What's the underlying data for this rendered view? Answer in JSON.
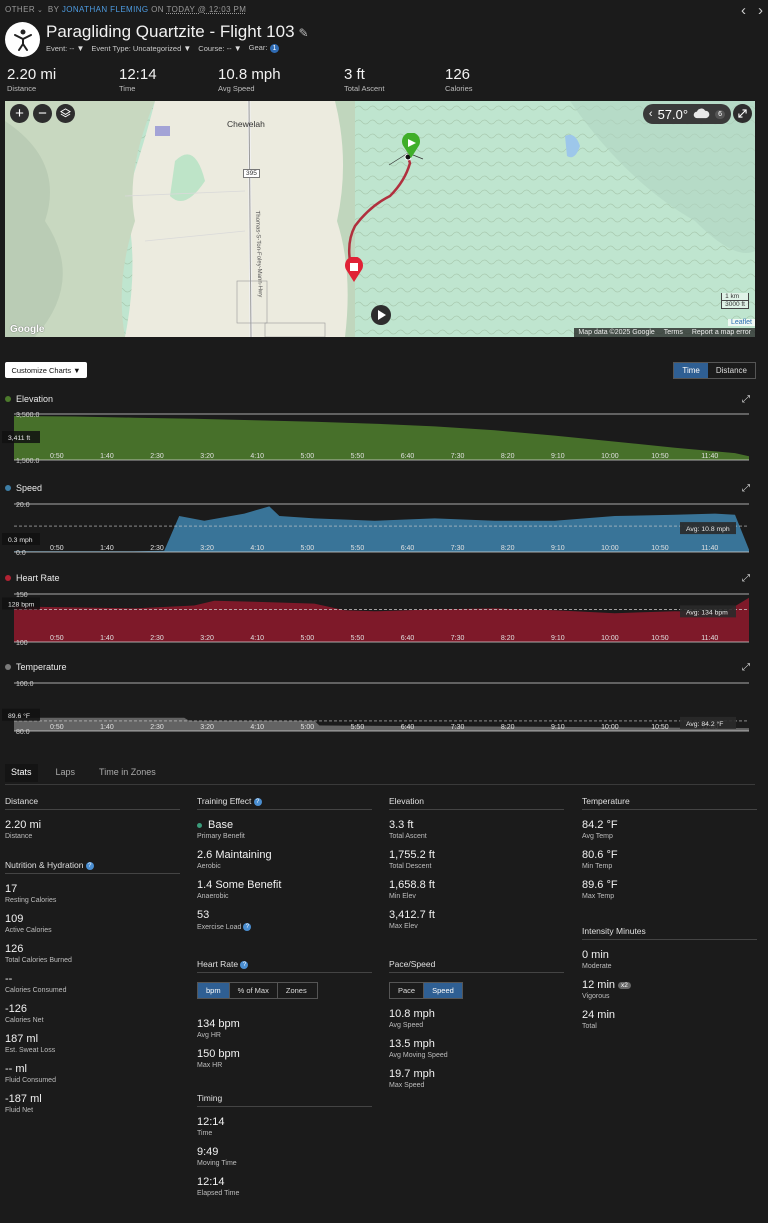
{
  "header": {
    "activity_type": "OTHER",
    "by": "BY",
    "author": "JONATHAN FLEMING",
    "on": "ON",
    "date": "TODAY @ 12:03 PM",
    "title": "Paragliding Quartzite - Flight 103",
    "event": "Event: --",
    "event_type": "Event Type: Uncategorized",
    "course": "Course: --",
    "gear": "Gear:",
    "gear_count": "1"
  },
  "summary": [
    {
      "value": "2.20 mi",
      "label": "Distance"
    },
    {
      "value": "12:14",
      "label": "Time"
    },
    {
      "value": "10.8 mph",
      "label": "Avg Speed"
    },
    {
      "value": "3 ft",
      "label": "Total Ascent"
    },
    {
      "value": "126",
      "label": "Calories"
    }
  ],
  "map": {
    "town": "Chewelah",
    "highway": "395",
    "road": "Thomas-S-Ton-Foley-Mann-Hwy",
    "temp": "57.0°",
    "weather_badge": "6",
    "scale_km": "1 km",
    "scale_ft": "3000 ft",
    "attribution": "Map data ©2025 Google",
    "terms": "Terms",
    "report": "Report a map error",
    "leaflet": "Leaflet",
    "google": "Google"
  },
  "controls": {
    "customize": "Customize Charts",
    "time": "Time",
    "distance": "Distance"
  },
  "x_ticks": [
    "0:50",
    "1:40",
    "2:30",
    "3:20",
    "4:10",
    "5:00",
    "5:50",
    "6:40",
    "7:30",
    "8:20",
    "9:10",
    "10:00",
    "10:50",
    "11:40"
  ],
  "chart_data": [
    {
      "type": "area",
      "title": "Elevation",
      "color": "#4c7a2c",
      "y_top": "3,500.0",
      "y_bottom": "1,500.0",
      "ylim": [
        1500,
        3500
      ],
      "marker": "3,411 ft",
      "avg_label": "",
      "x": [
        0,
        60,
        120,
        180,
        240,
        300,
        360,
        420,
        480,
        540,
        600,
        660,
        720,
        734
      ],
      "values": [
        3412,
        3390,
        3340,
        3290,
        3230,
        3160,
        3080,
        2960,
        2790,
        2560,
        2300,
        2030,
        1800,
        1659
      ]
    },
    {
      "type": "area",
      "title": "Speed",
      "color": "#3d7ea6",
      "y_top": "20.0",
      "y_bottom": "0.0",
      "ylim": [
        0,
        20
      ],
      "marker": "0.3 mph",
      "avg_label": "Avg: 10.8 mph",
      "avg": 10.8,
      "x": [
        0,
        120,
        150,
        165,
        190,
        230,
        255,
        265,
        300,
        360,
        420,
        480,
        540,
        600,
        660,
        700,
        720,
        734
      ],
      "values": [
        0.3,
        0.3,
        0.5,
        15.0,
        13.0,
        16.0,
        19.0,
        15.0,
        14.0,
        13.0,
        14.0,
        13.0,
        13.0,
        15.0,
        15.5,
        16.0,
        15.5,
        1.0
      ]
    },
    {
      "type": "area",
      "title": "Heart Rate",
      "color": "#8a1a2b",
      "y_top": "150",
      "y_bottom": "100",
      "ylim": [
        100,
        150
      ],
      "marker": "128 bpm",
      "avg_label": "Avg: 134 bpm",
      "avg": 134,
      "x": [
        0,
        60,
        120,
        180,
        200,
        240,
        300,
        330,
        360,
        420,
        480,
        540,
        600,
        660,
        710,
        734
      ],
      "values": [
        137,
        136,
        135,
        138,
        143,
        142,
        140,
        133,
        132,
        134,
        135,
        133,
        130,
        132,
        131,
        146
      ]
    },
    {
      "type": "area",
      "title": "Temperature",
      "color": "#6b6b6b",
      "y_top": "100.0",
      "y_bottom": "80.0",
      "ylim": [
        80,
        100
      ],
      "marker": "89.6 °F",
      "avg_label": "Avg: 84.2 °F",
      "avg": 84.2,
      "x": [
        0,
        170,
        175,
        300,
        305,
        734
      ],
      "values": [
        85.5,
        85.5,
        84.3,
        84.3,
        82.3,
        81.2
      ]
    }
  ],
  "stats_tabs": [
    "Stats",
    "Laps",
    "Time in Zones"
  ],
  "stats": {
    "distance": {
      "title": "Distance",
      "value": "2.20 mi",
      "label": "Distance"
    },
    "nutrition": {
      "title": "Nutrition & Hydration",
      "items": [
        {
          "value": "17",
          "label": "Resting Calories"
        },
        {
          "value": "109",
          "label": "Active Calories"
        },
        {
          "value": "126",
          "label": "Total Calories Burned"
        },
        {
          "value": "--",
          "label": "Calories Consumed"
        },
        {
          "value": "-126",
          "label": "Calories Net"
        },
        {
          "value": "187 ml",
          "label": "Est. Sweat Loss"
        },
        {
          "value": "-- ml",
          "label": "Fluid Consumed"
        },
        {
          "value": "-187 ml",
          "label": "Fluid Net"
        }
      ]
    },
    "training": {
      "title": "Training Effect",
      "items": [
        {
          "value": "Base",
          "label": "Primary Benefit"
        },
        {
          "value": "2.6 Maintaining",
          "label": "Aerobic"
        },
        {
          "value": "1.4 Some Benefit",
          "label": "Anaerobic"
        },
        {
          "value": "53",
          "label": "Exercise Load"
        }
      ]
    },
    "heart": {
      "title": "Heart Rate",
      "buttons": [
        "bpm",
        "% of Max",
        "Zones"
      ],
      "items": [
        {
          "value": "134 bpm",
          "label": "Avg HR"
        },
        {
          "value": "150 bpm",
          "label": "Max HR"
        }
      ]
    },
    "timing": {
      "title": "Timing",
      "items": [
        {
          "value": "12:14",
          "label": "Time"
        },
        {
          "value": "9:49",
          "label": "Moving Time"
        },
        {
          "value": "12:14",
          "label": "Elapsed Time"
        }
      ]
    },
    "elevation": {
      "title": "Elevation",
      "items": [
        {
          "value": "3.3 ft",
          "label": "Total Ascent"
        },
        {
          "value": "1,755.2 ft",
          "label": "Total Descent"
        },
        {
          "value": "1,658.8 ft",
          "label": "Min Elev"
        },
        {
          "value": "3,412.7 ft",
          "label": "Max Elev"
        }
      ]
    },
    "pace": {
      "title": "Pace/Speed",
      "buttons": [
        "Pace",
        "Speed"
      ],
      "items": [
        {
          "value": "10.8 mph",
          "label": "Avg Speed"
        },
        {
          "value": "13.5 mph",
          "label": "Avg Moving Speed"
        },
        {
          "value": "19.7 mph",
          "label": "Max Speed"
        }
      ]
    },
    "temperature": {
      "title": "Temperature",
      "items": [
        {
          "value": "84.2 °F",
          "label": "Avg Temp"
        },
        {
          "value": "80.6 °F",
          "label": "Min Temp"
        },
        {
          "value": "89.6 °F",
          "label": "Max Temp"
        }
      ]
    },
    "intensity": {
      "title": "Intensity Minutes",
      "multiplier": "x2",
      "items": [
        {
          "value": "0 min",
          "label": "Moderate"
        },
        {
          "value": "12 min",
          "label": "Vigorous"
        },
        {
          "value": "24 min",
          "label": "Total"
        }
      ]
    }
  }
}
